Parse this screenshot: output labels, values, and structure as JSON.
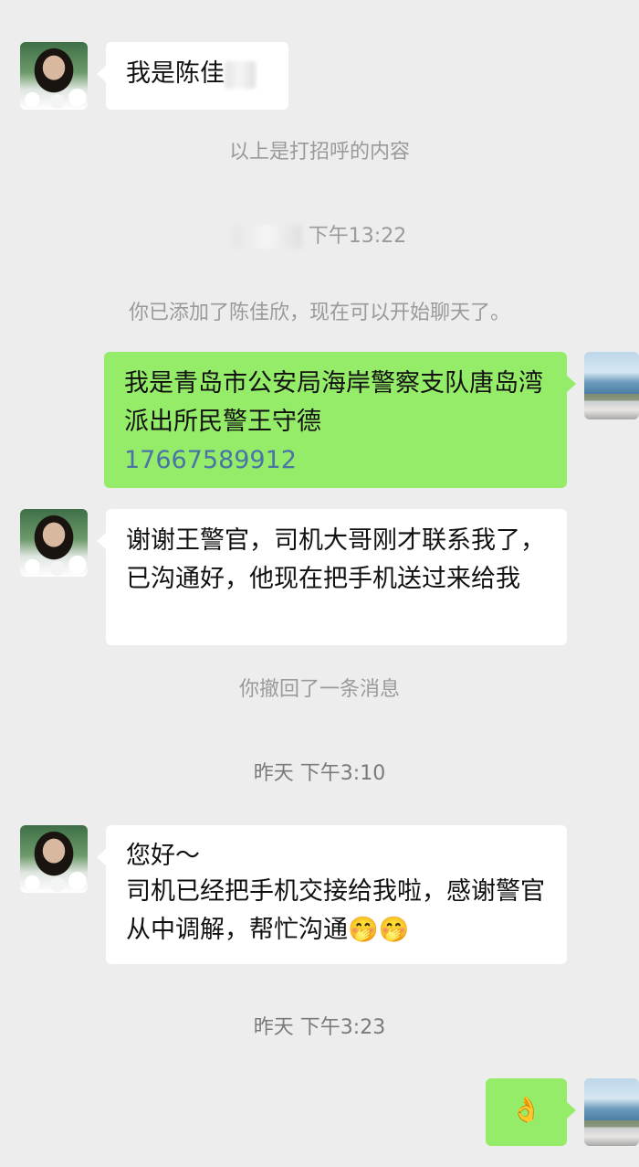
{
  "messages": {
    "m1_text": "我是陈佳",
    "greeting_note": "以上是打招呼的内容",
    "time1": "下午13:22",
    "added_note": "你已添加了陈佳欣，现在可以开始聊天了。",
    "m2_text": "我是青岛市公安局海岸警察支队唐岛湾派出所民警王守德",
    "m2_phone": "17667589912",
    "m3_text": "谢谢王警官，司机大哥刚才联系我了，已沟通好，他现在把手机送过来给我",
    "recall_note": "你撤回了一条消息",
    "time2": "昨天 下午3:10",
    "m4_line1": "您好～",
    "m4_line2": " 司机已经把手机交接给我啦，感谢警官从中调解，帮忙沟通",
    "m4_emoji": "🤭🤭",
    "time3": "昨天 下午3:23",
    "m5_emoji": "👌"
  },
  "icons": {
    "contact_avatar": "woman-with-flowers-avatar",
    "self_avatar": "coastal-city-avatar",
    "ok_hand": "ok-hand-emoji"
  },
  "colors": {
    "background": "#ededed",
    "sent_bubble": "#95ec69",
    "received_bubble": "#ffffff",
    "system_text": "#9a9a9a",
    "link": "#4a73a6"
  }
}
